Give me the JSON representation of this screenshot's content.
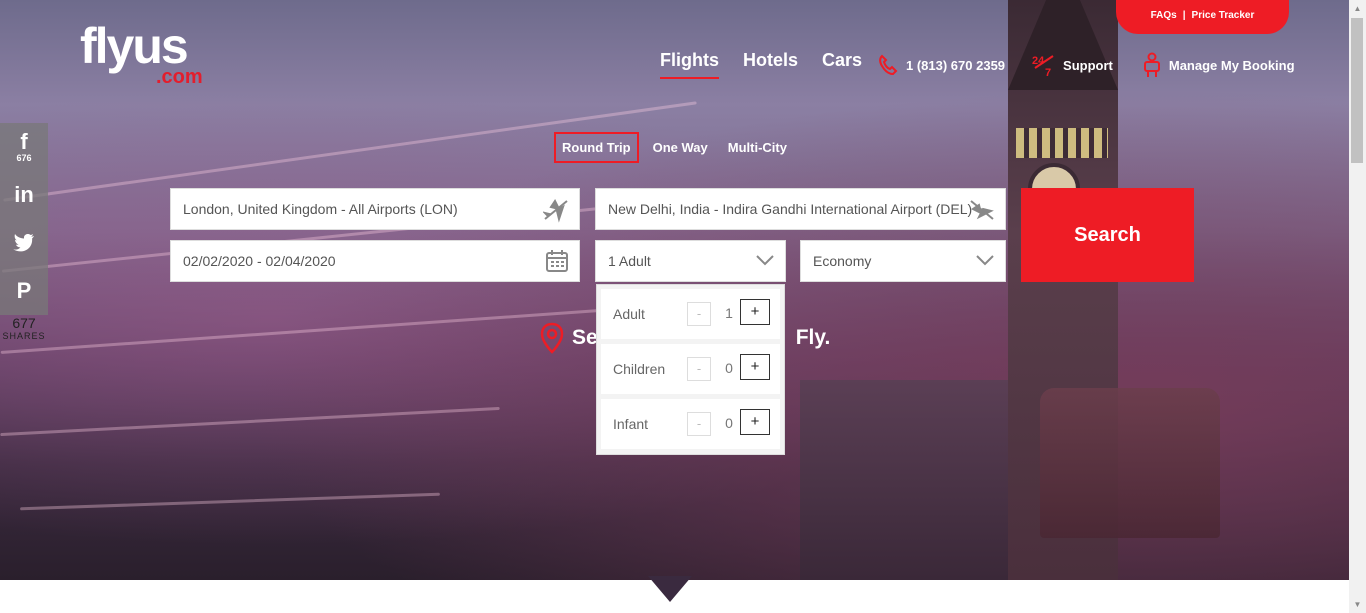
{
  "brand": {
    "logo_main": "flyus",
    "logo_sub": ".com"
  },
  "top_tab": {
    "faqs": "FAQs",
    "separator": "|",
    "price_tracker": "Price Tracker"
  },
  "nav": {
    "flights": "Flights",
    "hotels": "Hotels",
    "cars": "Cars"
  },
  "header_links": {
    "phone": "1 (813) 670 2359",
    "support": "Support",
    "support_badge": "24/7",
    "manage_booking": "Manage My Booking"
  },
  "share": {
    "facebook_count": "676",
    "total": "677",
    "total_label": "SHARES"
  },
  "trip_types": [
    "Round Trip",
    "One Way",
    "Multi-City"
  ],
  "search_form": {
    "from": "London, United Kingdom - All Airports (LON)",
    "to": "New Delhi, India - Indira Gandhi International Airport (DEL)",
    "dates": "02/02/2020 - 02/04/2020",
    "passengers": "1 Adult",
    "cabin": "Economy",
    "search_button": "Search"
  },
  "tagline": {
    "start": "Se",
    "end": "Fly."
  },
  "pax_dropdown": {
    "rows": [
      {
        "label": "Adult",
        "value": "1",
        "minus": "-",
        "plus": "+"
      },
      {
        "label": "Children",
        "value": "0",
        "minus": "-",
        "plus": "+"
      },
      {
        "label": "Infant",
        "value": "0",
        "minus": "-",
        "plus": "+"
      }
    ]
  },
  "colors": {
    "brand_red": "#ee1c25",
    "white": "#ffffff"
  }
}
